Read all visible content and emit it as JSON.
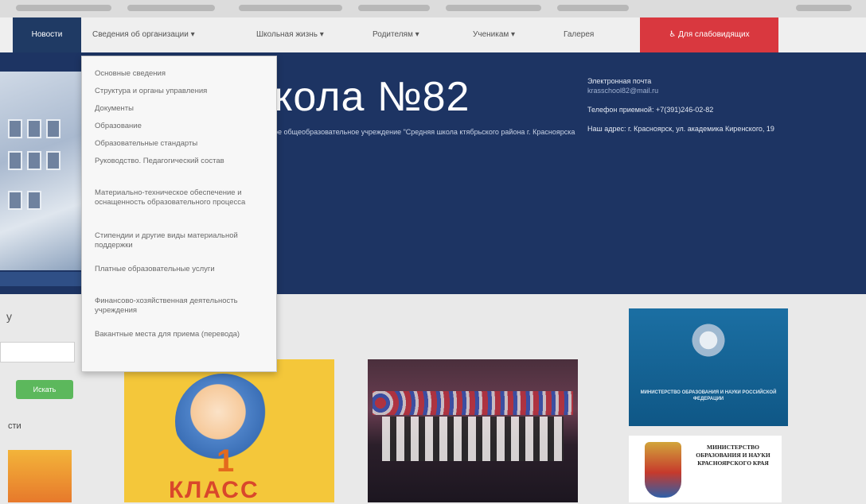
{
  "nav": {
    "items": [
      {
        "label": "Новости"
      },
      {
        "label": "Сведения об организации ▾"
      },
      {
        "label": "Школьная жизнь ▾"
      },
      {
        "label": "Родителям ▾"
      },
      {
        "label": "Ученикам ▾"
      },
      {
        "label": "Галерея"
      },
      {
        "label": "♿ Для слабовидящих"
      }
    ]
  },
  "dropdown": {
    "items": [
      "Основные сведения",
      "Структура и органы управления",
      "Документы",
      "Образование",
      "Образовательные стандарты",
      "Руководство. Педагогический состав",
      "Материально-техническое обеспечение и оснащенность образовательного процесса",
      "Стипендии и другие виды материальной поддержки",
      "Платные образовательные услуги",
      "Финансово-хозяйственная деятельность учреждения",
      "Вакантные места для приема (перевода)"
    ]
  },
  "header": {
    "title": "кола №82",
    "subtitle": "ое общеобразовательное учреждение \"Средняя школа ктябрьского района г. Красноярска",
    "email_label": "Электронная почта",
    "email": "krasschool82@mail.ru",
    "phone": "Телефон приемной: +7(391)246-02-82",
    "address": "Наш адрес: г. Красноярск, ул. академика Киренского, 19"
  },
  "sidebar": {
    "letter": "у",
    "search_button": "Искать",
    "news_label": "сти"
  },
  "book": {
    "number": "1",
    "word": "КЛАСС"
  },
  "ministry1": {
    "text": "МИНИСТЕРСТВО ОБРАЗОВАНИЯ И НАУКИ РОССИЙСКОЙ ФЕДЕРАЦИИ"
  },
  "ministry2": {
    "text": "МИНИСТЕРСТВО ОБРАЗОВАНИЯ И НАУКИ КРАСНОЯРСКОГО КРАЯ"
  }
}
